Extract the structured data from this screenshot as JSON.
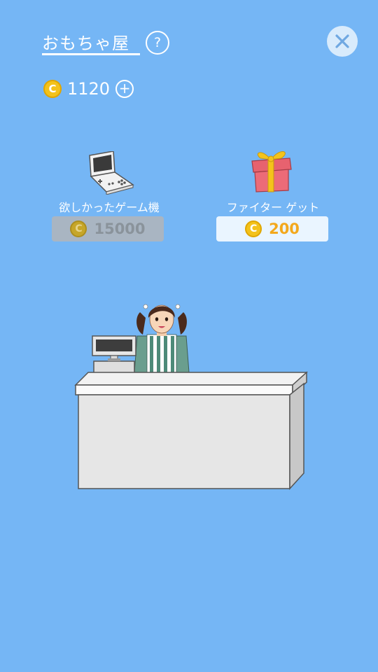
{
  "header": {
    "title": "おもちゃ屋",
    "help_label": "?",
    "close_label": "×"
  },
  "wallet": {
    "coin_symbol": "C",
    "balance": "1120",
    "add_label": "+"
  },
  "shop_items": [
    {
      "name": "欲しかったゲーム機",
      "price": "15000",
      "icon": "game-console-icon",
      "affordable": false
    },
    {
      "name": "ファイター ゲット",
      "price": "200",
      "icon": "gift-box-icon",
      "affordable": true
    }
  ],
  "colors": {
    "background": "#75b6f5",
    "coin": "#f3c21b",
    "price_affordable": "#f3a81c",
    "price_disabled": "#a9b5c2"
  }
}
